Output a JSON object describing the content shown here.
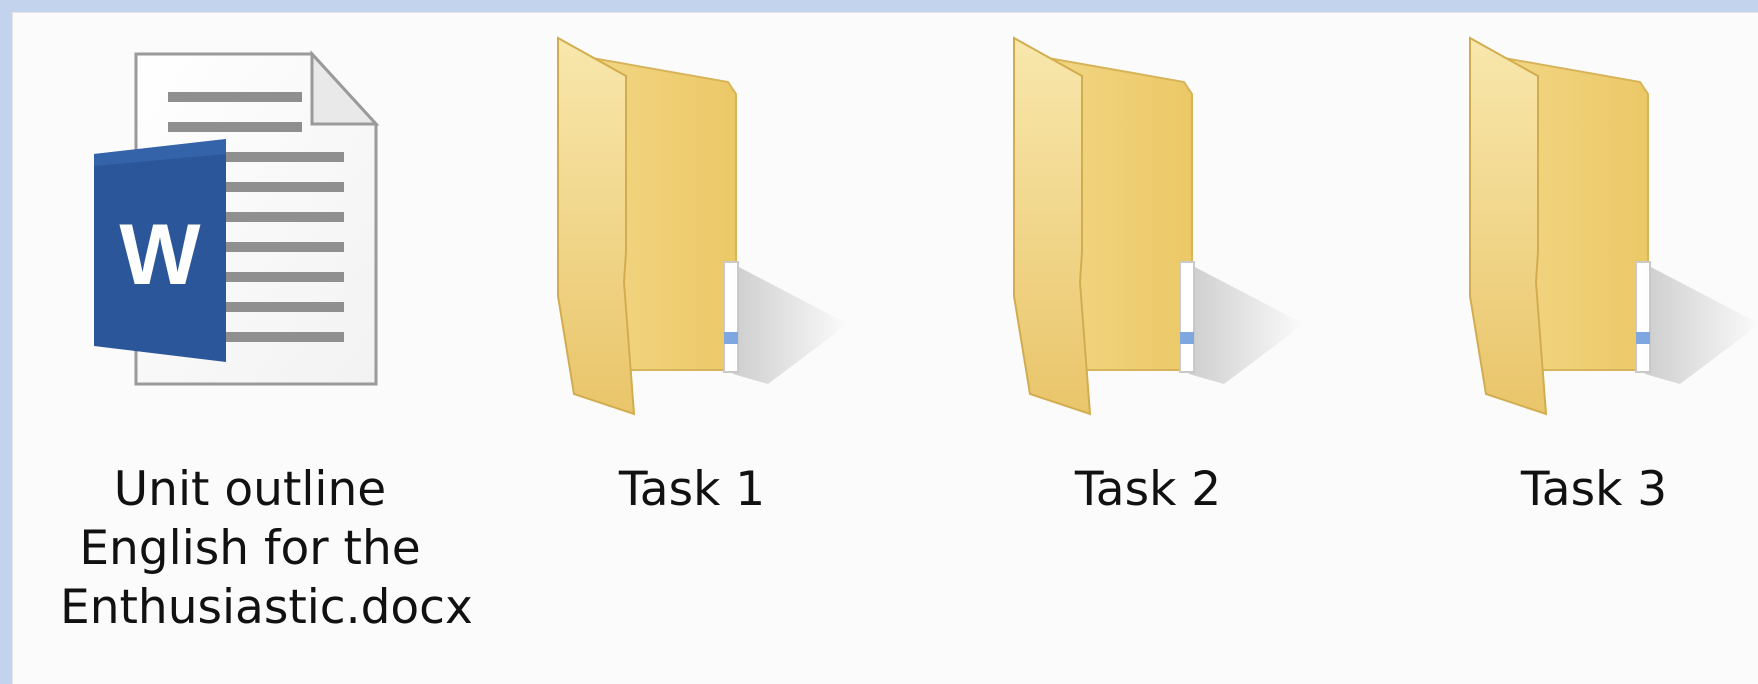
{
  "desktop": {
    "items": [
      {
        "type": "word-document",
        "icon": "word-document-icon",
        "label_lines": [
          "Unit outline",
          "English for the",
          "Enthusiastic.docx"
        ]
      },
      {
        "type": "folder",
        "icon": "folder-icon",
        "label": "Task 1"
      },
      {
        "type": "folder",
        "icon": "folder-icon",
        "label": "Task 2"
      },
      {
        "type": "folder",
        "icon": "folder-icon",
        "label": "Task 3"
      }
    ]
  },
  "colors": {
    "frame": "#c3d3ee",
    "background": "#fbfbfb",
    "folder": "#f3d98b",
    "word_blue": "#2b579a"
  }
}
